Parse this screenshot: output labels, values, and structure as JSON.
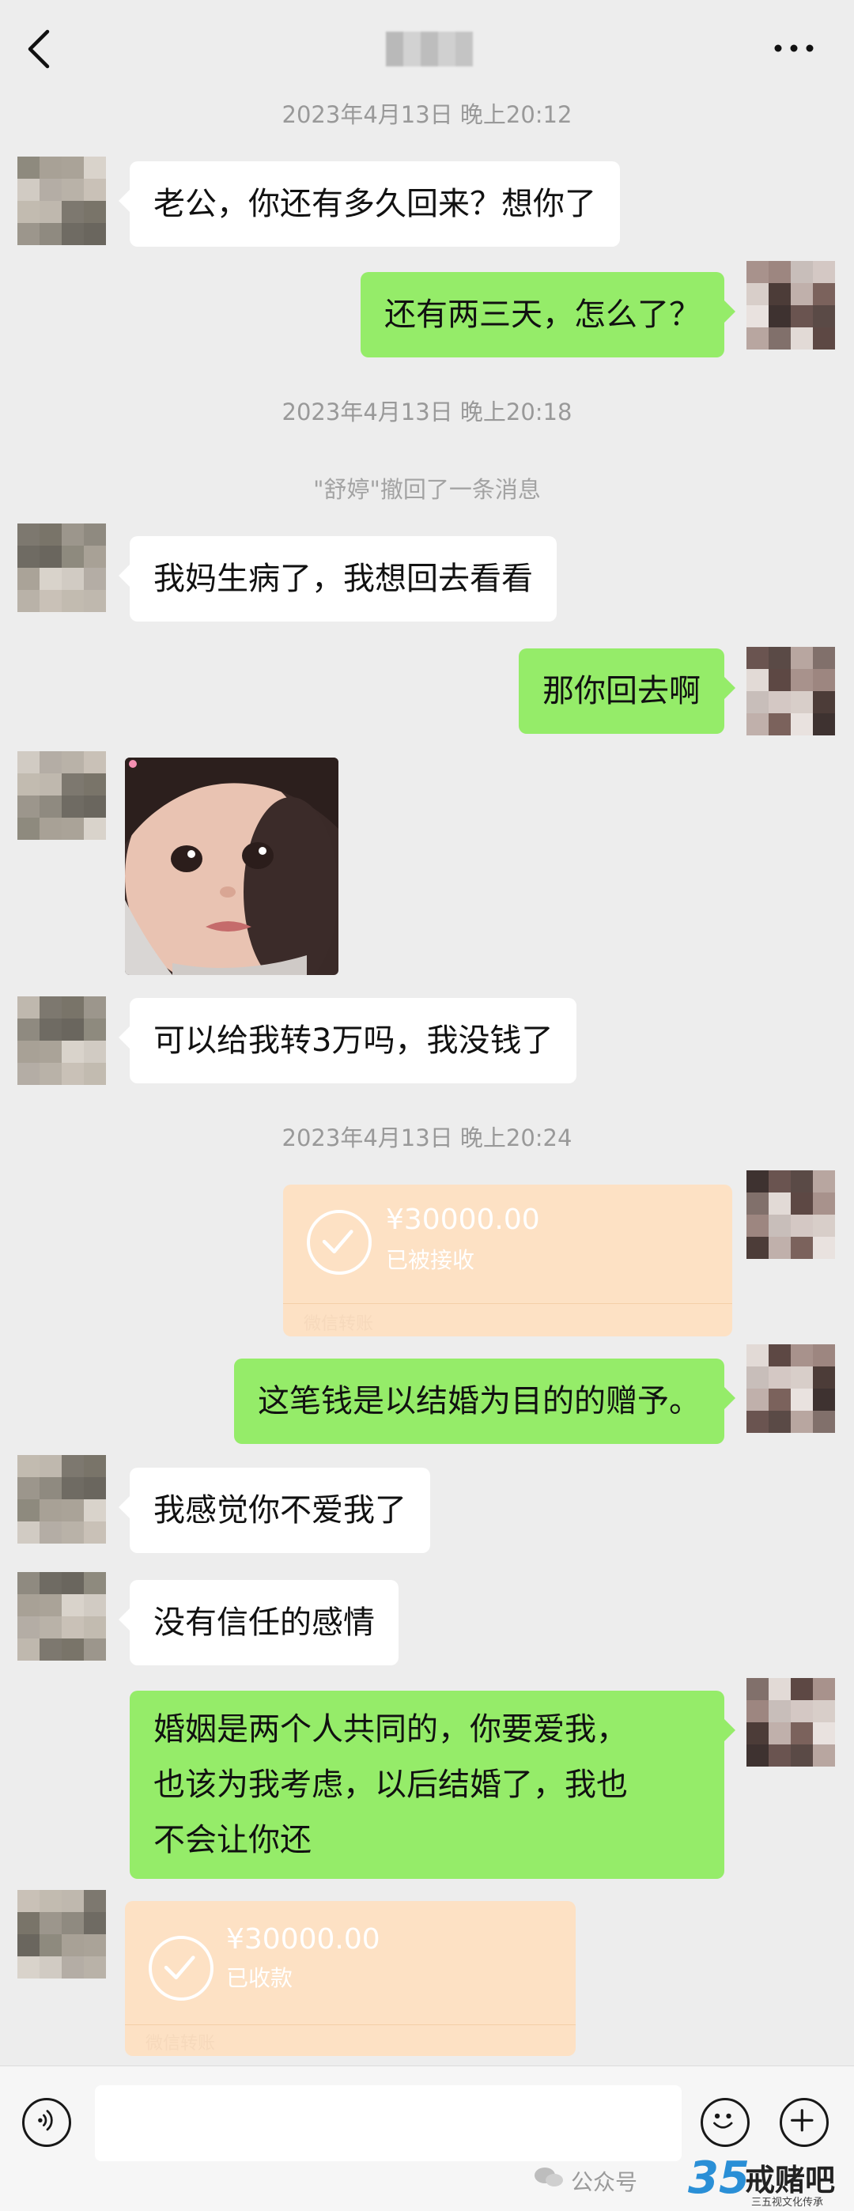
{
  "header": {
    "back_icon": "chevron-left-icon",
    "more_icon": "more-dots-icon"
  },
  "messages": {
    "ts1": "2023年4月13日 晚上20:12",
    "m1": "老公，你还有多久回来？想你了",
    "m2": "还有两三天，怎么了？",
    "ts2": "2023年4月13日 晚上20:18",
    "recall": "\"舒婷\"撤回了一条消息",
    "m3": "我妈生病了，我想回去看看",
    "m4": "那你回去啊",
    "m5": "可以给我转3万吗，我没钱了",
    "ts3": "2023年4月13日 晚上20:24",
    "t1_amount": "¥30000.00",
    "t1_status": "已被接收",
    "t1_foot": "微信转账",
    "m6": "这笔钱是以结婚为目的的赠予。",
    "m7": "我感觉你不爱我了",
    "m8": "没有信任的感情",
    "m9_l1": "婚姻是两个人共同的，你要爱我，",
    "m9_l2": "也该为我考虑，以后结婚了，我也",
    "m9_l3": "不会让你还",
    "t2_amount": "¥30000.00",
    "t2_status": "已收款",
    "t2_foot": "微信转账"
  },
  "input_bar": {
    "voice_icon": "voice-icon",
    "emoji_icon": "emoji-icon",
    "plus_icon": "plus-icon"
  },
  "watermark": {
    "text": "公众号",
    "brand_number": "35",
    "brand": "戒赌吧",
    "slogan": "三五视文化传承"
  },
  "colors": {
    "background": "#ededed",
    "my_bubble": "#95ec69",
    "their_bubble": "#ffffff",
    "transfer": "#fde1c4"
  }
}
